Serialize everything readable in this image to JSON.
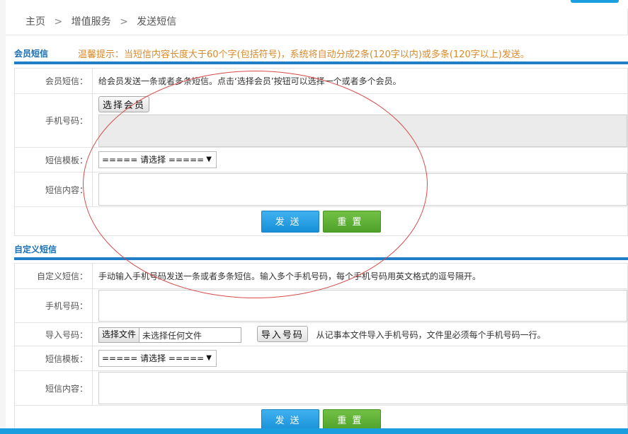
{
  "breadcrumb": {
    "home": "主页",
    "sep1": ">",
    "service": "增值服务",
    "sep2": ">",
    "current": "发送短信"
  },
  "member_sms": {
    "title": "会员短信",
    "hint": "温馨提示：当短信内容长度大于60个字(包括符号)，系统将自动分成2条(120字以内)或多条(120字以上)发送。",
    "rows": {
      "desc_label": "会员短信：",
      "desc_text": "给会员发送一条或者多条短信。点击‘选择会员’按钮可以选择一个或者多个会员。",
      "phone_label": "手机号码：",
      "select_member_btn": "选择会员",
      "template_label": "短信模板：",
      "template_value": "===== 请选择 =====",
      "content_label": "短信内容："
    },
    "send_btn": "发送",
    "reset_btn": "重置"
  },
  "custom_sms": {
    "title": "自定义短信",
    "rows": {
      "desc_label": "自定义短信：",
      "desc_text": "手动输入手机号码发送一条或者多条短信。输入多个手机号码，每个手机号码用英文格式的逗号隔开。",
      "phone_label": "手机号码：",
      "import_label": "导入号码：",
      "choose_file_btn": "选择文件",
      "no_file_text": "未选择任何文件",
      "import_btn": "导入号码",
      "import_note": "从记事本文件导入手机号码，文件里必须每个手机号码一行。",
      "template_label": "短信模板：",
      "template_value": "===== 请选择 =====",
      "content_label": "短信内容："
    },
    "send_btn": "发送",
    "reset_btn": "重置"
  },
  "colors": {
    "accent": "#1f7ec6",
    "hint": "#d98a2b",
    "send": "#1a9ee0",
    "reset": "#4ea12a",
    "annotation": "#d84a4a"
  }
}
